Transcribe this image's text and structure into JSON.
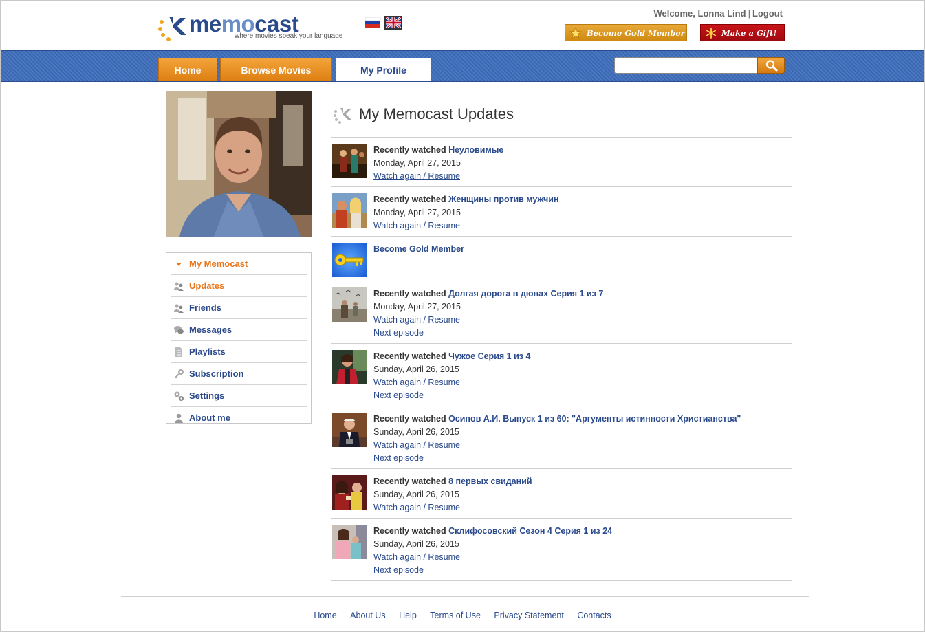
{
  "brand": {
    "name_part1": "me",
    "name_part2": "mo",
    "name_part3": "cast",
    "tagline": "where movies speak your language"
  },
  "languages": [
    {
      "name": "Russian",
      "icon": "russian-flag-icon"
    },
    {
      "name": "English",
      "icon": "uk-flag-icon",
      "selected": true
    }
  ],
  "user_bar": {
    "welcome": "Welcome, Lonna Lind",
    "separator": "|",
    "logout": "Logout"
  },
  "cta": {
    "gold_label": "Become Gold Member",
    "gold_icon": "star-icon",
    "gift_label": "Make a Gift!",
    "gift_icon": "snowflake-icon"
  },
  "nav": {
    "tabs": [
      {
        "label": "Home"
      },
      {
        "label": "Browse Movies"
      },
      {
        "label": "My Profile",
        "active": true
      }
    ],
    "search_value": "",
    "search_icon": "magnifier-icon"
  },
  "sidebar": {
    "items": [
      {
        "label": "My Memocast",
        "icon": "triangle-down-icon",
        "active": true
      },
      {
        "label": "Updates",
        "icon": "people-icon",
        "current": true
      },
      {
        "label": "Friends",
        "icon": "people-icon"
      },
      {
        "label": "Messages",
        "icon": "chat-bubbles-icon"
      },
      {
        "label": "Playlists",
        "icon": "document-icon"
      },
      {
        "label": "Subscription",
        "icon": "key-icon"
      },
      {
        "label": "Settings",
        "icon": "gears-icon"
      },
      {
        "label": "About me",
        "icon": "person-icon"
      }
    ]
  },
  "feed": {
    "title": "My Memocast Updates",
    "items": [
      {
        "prefix": "Recently watched",
        "title": "Неуловимые",
        "date": "Monday, April 27, 2015",
        "action": "Watch again / Resume"
      },
      {
        "prefix": "Recently watched",
        "title": "Женщины против мужчин",
        "date": "Monday, April 27, 2015",
        "action": "Watch again / Resume"
      },
      {
        "title": "Become Gold Member"
      },
      {
        "prefix": "Recently watched",
        "title": "Долгая дорога в дюнах Серия 1 из 7",
        "date": "Monday, April 27, 2015",
        "action": "Watch again / Resume",
        "next": "Next episode"
      },
      {
        "prefix": "Recently watched",
        "title": "Чужое Серия 1 из 4",
        "date": "Sunday, April 26, 2015",
        "action": "Watch again / Resume",
        "next": "Next episode"
      },
      {
        "prefix": "Recently watched",
        "title": "Осипов А.И. Выпуск 1 из 60: \"Аргументы истинности Христианства\"",
        "date": "Sunday, April 26, 2015",
        "action": "Watch again / Resume",
        "next": "Next episode"
      },
      {
        "prefix": "Recently watched",
        "title": "8 первых свиданий",
        "date": "Sunday, April 26, 2015",
        "action": "Watch again / Resume"
      },
      {
        "prefix": "Recently watched",
        "title": "Склифосовский Сезон 4 Серия 1 из 24",
        "date": "Sunday, April 26, 2015",
        "action": "Watch again / Resume",
        "next": "Next episode"
      }
    ]
  },
  "footer": {
    "links": [
      "Home",
      "About Us",
      "Help",
      "Terms of Use",
      "Privacy Statement",
      "Contacts"
    ]
  },
  "colors": {
    "nav_blue": "#3b67b1",
    "tab_orange": "#e8931f",
    "link_blue": "#2a4a8c",
    "active_orange": "#e8761c",
    "gift_red": "#b50f14"
  }
}
